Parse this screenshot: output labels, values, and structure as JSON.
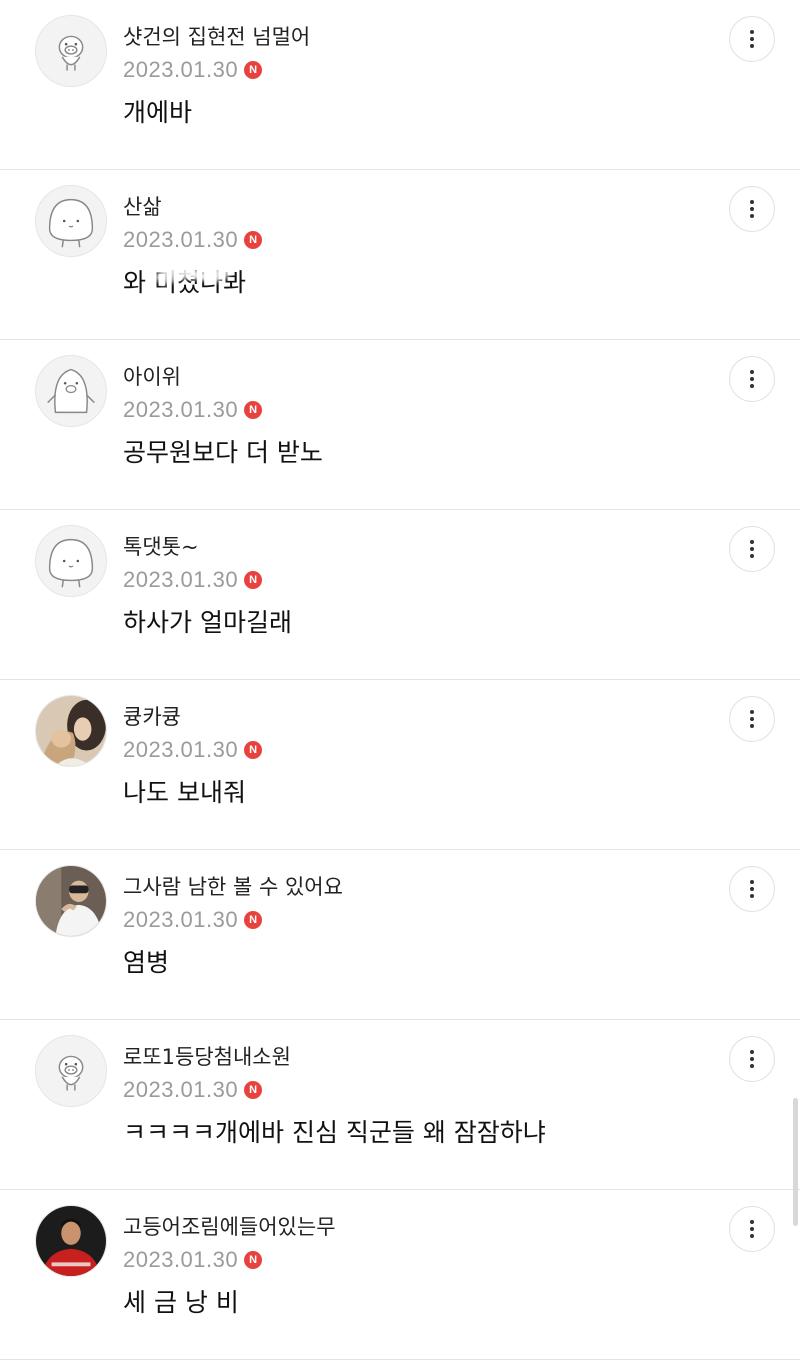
{
  "comments": [
    {
      "nickname": "샷건의 집현전 넘멀어",
      "date": "2023.01.30",
      "badge": "N",
      "text": "개에바",
      "avatar_icon": "pig-character-icon"
    },
    {
      "nickname": "산삶",
      "date": "2023.01.30",
      "badge": "N",
      "text": "와 미쳤나봐",
      "avatar_icon": "blob-character-icon"
    },
    {
      "nickname": "아이위",
      "date": "2023.01.30",
      "badge": "N",
      "text": "공무원보다 더 받노",
      "avatar_icon": "penguin-character-icon"
    },
    {
      "nickname": "톡댓톳~",
      "date": "2023.01.30",
      "badge": "N",
      "text": "하사가 얼마길래",
      "avatar_icon": "blob-character-icon"
    },
    {
      "nickname": "큥카큥",
      "date": "2023.01.30",
      "badge": "N",
      "text": "나도 보내줘",
      "avatar_icon": "photo-avatar-icon"
    },
    {
      "nickname": "그사람 남한 볼 수 있어요",
      "date": "2023.01.30",
      "badge": "N",
      "text": "염병",
      "avatar_icon": "photo-avatar-icon"
    },
    {
      "nickname": "로또1등당첨내소원",
      "date": "2023.01.30",
      "badge": "N",
      "text": "ㅋㅋㅋㅋ개에바 진심 직군들 왜 잠잠하냐",
      "avatar_icon": "pig-character-icon"
    },
    {
      "nickname": "고등어조림에들어있는무",
      "date": "2023.01.30",
      "badge": "N",
      "text": "세 금 낭 비",
      "avatar_icon": "photo-avatar-icon"
    }
  ],
  "colors": {
    "date": "#9a9a9a",
    "new_badge": "#e8423f",
    "divider": "#e4e4e4"
  }
}
